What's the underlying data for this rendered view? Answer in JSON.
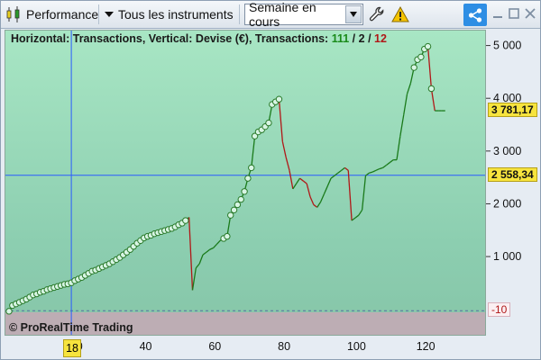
{
  "toolbar": {
    "title": "Performance",
    "instruments_label": "Tous les instruments",
    "period_select": "Semaine en cours",
    "icons": [
      "chart-candle-icon",
      "dropdown-triangle-icon",
      "wrench-icon",
      "warning-icon",
      "share-icon",
      "minimize-icon",
      "maximize-icon",
      "close-icon"
    ]
  },
  "chart": {
    "title_prefix": "Horizontal: Transactions, Vertical: Devise (€), Transactions:",
    "count_total": "111",
    "separator": "/",
    "count_mid": "2",
    "count_losing": "12",
    "copyright": "© ProRealTime Trading",
    "price_current": "3 781,17",
    "price_cursor": "2 558,34",
    "negative_label": "-10",
    "cursor_x_label": "18",
    "colors": {
      "up": "#1a7a1a",
      "down": "#b01818",
      "cursor": "#2a5cff"
    }
  },
  "chart_data": {
    "type": "line",
    "xlabel": "",
    "ylabel": "",
    "xlim": [
      0,
      137
    ],
    "ylim": [
      -500,
      5300
    ],
    "x_ticks": [
      "20",
      "40",
      "60",
      "80",
      "100",
      "120"
    ],
    "y_ticks": [
      "1 000",
      "2 000",
      "3 000",
      "4 000",
      "5 000"
    ],
    "grid": false,
    "cursor": {
      "x": 18,
      "y": 2558.34
    },
    "zero_line_value": -10,
    "equity": {
      "x": [
        0,
        1,
        2,
        3,
        4,
        5,
        6,
        7,
        8,
        9,
        10,
        11,
        12,
        13,
        14,
        15,
        16,
        17,
        18,
        19,
        20,
        21,
        22,
        23,
        24,
        25,
        26,
        27,
        28,
        29,
        30,
        31,
        32,
        33,
        34,
        35,
        36,
        37,
        38,
        39,
        40,
        41,
        42,
        43,
        44,
        45,
        46,
        47,
        48,
        49,
        50,
        51,
        52,
        53,
        54,
        55,
        56,
        57,
        58,
        59,
        60,
        61,
        62,
        63,
        64,
        65,
        66,
        67,
        68,
        69,
        70,
        71,
        72,
        73,
        74,
        75,
        76,
        77,
        78,
        79,
        80,
        81,
        82,
        83,
        84,
        85,
        86,
        87,
        88,
        89,
        90,
        91,
        92,
        93,
        94,
        95,
        96,
        97,
        98,
        99,
        100,
        101,
        102,
        103,
        104,
        105,
        106,
        107,
        108,
        109,
        110,
        111,
        112,
        113,
        114,
        115,
        116,
        117,
        118,
        119,
        120,
        121,
        122,
        123,
        124,
        125,
        126
      ],
      "y": [
        -20,
        90,
        120,
        150,
        180,
        210,
        250,
        290,
        310,
        340,
        360,
        390,
        410,
        430,
        450,
        470,
        490,
        500,
        520,
        560,
        590,
        620,
        660,
        700,
        740,
        760,
        790,
        820,
        850,
        880,
        920,
        960,
        1000,
        1050,
        1100,
        1150,
        1210,
        1270,
        1320,
        1370,
        1400,
        1420,
        1450,
        1470,
        1490,
        1510,
        1530,
        1550,
        1580,
        1620,
        1650,
        1700,
        1760,
        380,
        800,
        880,
        1050,
        1100,
        1150,
        1180,
        1250,
        1320,
        1360,
        1400,
        1800,
        1900,
        2000,
        2100,
        2250,
        2500,
        2700,
        3300,
        3380,
        3420,
        3480,
        3550,
        3900,
        3950,
        4000,
        3200,
        2900,
        2650,
        2300,
        2400,
        2500,
        2450,
        2400,
        2150,
        2000,
        1950,
        2050,
        2200,
        2350,
        2500,
        2550,
        2600,
        2650,
        2700,
        2650,
        1700,
        1750,
        1800,
        1900,
        2550,
        2600,
        2620,
        2650,
        2680,
        2700,
        2750,
        2800,
        2850,
        2850,
        3300,
        3700,
        4100,
        4300,
        4600,
        4750,
        4800,
        4950,
        5000,
        4200,
        3781,
        3781,
        3781,
        3781
      ],
      "trade_markers_x": [
        0,
        1,
        2,
        3,
        4,
        5,
        6,
        7,
        8,
        9,
        10,
        11,
        12,
        13,
        14,
        15,
        16,
        17,
        18,
        19,
        20,
        21,
        22,
        23,
        24,
        25,
        26,
        27,
        28,
        29,
        30,
        31,
        32,
        33,
        34,
        35,
        36,
        37,
        38,
        39,
        40,
        41,
        42,
        43,
        44,
        45,
        46,
        47,
        48,
        49,
        50,
        51,
        62,
        63,
        64,
        65,
        66,
        67,
        68,
        69,
        70,
        71,
        72,
        73,
        74,
        75,
        76,
        77,
        78,
        117,
        118,
        119,
        120,
        121,
        122
      ]
    }
  }
}
